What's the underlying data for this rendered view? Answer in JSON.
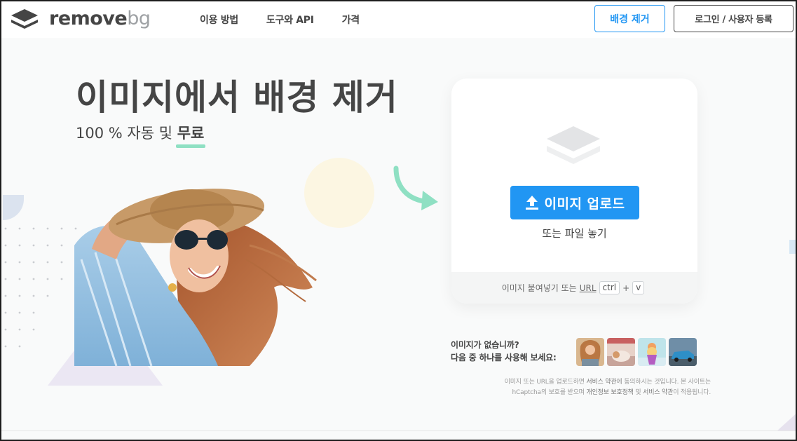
{
  "brand": {
    "name_part1": "remove",
    "name_part2": "bg"
  },
  "nav": {
    "items": [
      "이용 방법",
      "도구와 API",
      "가격"
    ]
  },
  "header": {
    "remove_bg_label": "배경 제거",
    "login_label": "로그인 / 사용자 등록"
  },
  "hero": {
    "title": "이미지에서 배경 제거",
    "subtitle_prefix": "100 % 자동 및 ",
    "subtitle_highlight": "무료"
  },
  "upload": {
    "button_label": "이미지 업로드",
    "drop_text": "또는 파일 놓기",
    "paste_text": "이미지 붙여넣기 또는",
    "paste_url": "URL",
    "key_ctrl": "ctrl",
    "key_plus": "+",
    "key_v": "v"
  },
  "samples": {
    "line1": "이미지가 없습니까?",
    "line2": "다음 중 하나를 사용해 보세요:"
  },
  "legal": {
    "line1_a": "이미지 또는 URL을 업로드하면 ",
    "line1_b": "서비스 약관",
    "line1_c": "에 동의하시는 것입니다. 본 사이트는",
    "line2_a": "hCaptcha의 보호를 받으며 ",
    "line2_b": "개인정보 보호정책",
    "line2_c": " 및 ",
    "line2_d": "서비스 약관",
    "line2_e": "이 적용됩니다."
  },
  "colors": {
    "accent": "#2196f3",
    "text": "#454545",
    "highlight": "#8fe0c3",
    "arrow": "#8fe0c3"
  }
}
